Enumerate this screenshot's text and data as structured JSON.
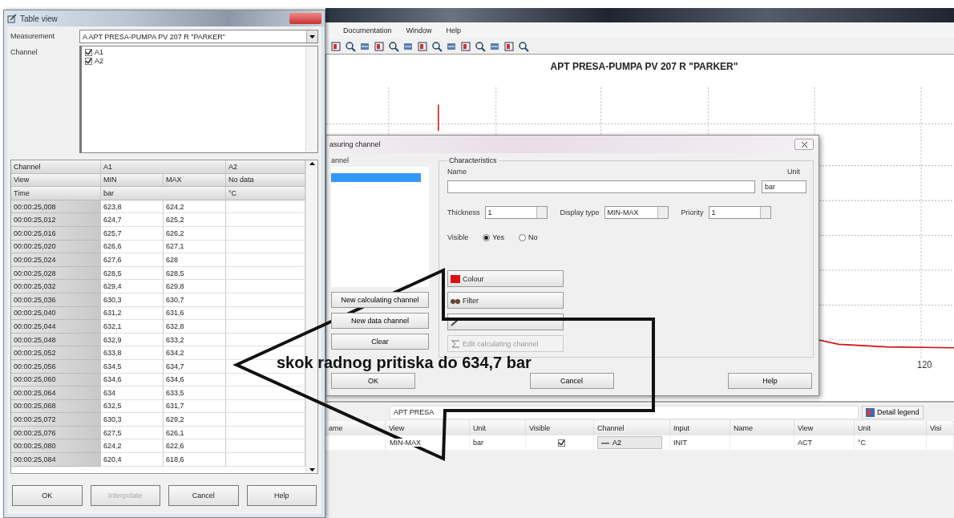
{
  "table_view": {
    "title": "Table view",
    "measurement_label": "Measurement",
    "measurement_value": "A APT PRESA-PUMPA PV 207 R \"PARKER\"",
    "channel_label": "Channel",
    "channels": [
      {
        "label": "A1",
        "checked": true
      },
      {
        "label": "A2",
        "checked": true
      }
    ],
    "header": {
      "channel": [
        "Channel",
        "A1",
        "A2"
      ],
      "view": [
        "View",
        "MIN",
        "MAX",
        "No data"
      ],
      "units": [
        "Time",
        "bar",
        "°C"
      ]
    },
    "rows": [
      {
        "time": "00:00:25,008",
        "min": "623,8",
        "max": "624,2"
      },
      {
        "time": "00:00:25,012",
        "min": "624,7",
        "max": "625,2"
      },
      {
        "time": "00:00:25,016",
        "min": "625,7",
        "max": "626,2"
      },
      {
        "time": "00:00:25,020",
        "min": "626,6",
        "max": "627,1"
      },
      {
        "time": "00:00:25,024",
        "min": "627,6",
        "max": "628"
      },
      {
        "time": "00:00:25,028",
        "min": "628,5",
        "max": "628,5"
      },
      {
        "time": "00:00:25,032",
        "min": "629,4",
        "max": "629,8"
      },
      {
        "time": "00:00:25,036",
        "min": "630,3",
        "max": "630,7"
      },
      {
        "time": "00:00:25,040",
        "min": "631,2",
        "max": "631,6"
      },
      {
        "time": "00:00:25,044",
        "min": "632,1",
        "max": "632,8"
      },
      {
        "time": "00:00:25,048",
        "min": "632,9",
        "max": "633,2"
      },
      {
        "time": "00:00:25,052",
        "min": "633,8",
        "max": "634,2"
      },
      {
        "time": "00:00:25,056",
        "min": "634,5",
        "max": "634,7"
      },
      {
        "time": "00:00:25,060",
        "min": "634,6",
        "max": "634,6"
      },
      {
        "time": "00:00:25,064",
        "min": "634",
        "max": "633,5"
      },
      {
        "time": "00:00:25,068",
        "min": "632,5",
        "max": "631,7"
      },
      {
        "time": "00:00:25,072",
        "min": "630,3",
        "max": "629,2"
      },
      {
        "time": "00:00:25,076",
        "min": "627,5",
        "max": "626,1"
      },
      {
        "time": "00:00:25,080",
        "min": "624,2",
        "max": "622,6"
      },
      {
        "time": "00:00:25,084",
        "min": "620,4",
        "max": "618,6"
      }
    ],
    "buttons": [
      {
        "label": "OK",
        "disabled": false
      },
      {
        "label": "Interpolate",
        "disabled": true
      },
      {
        "label": "Cancel",
        "disabled": false
      },
      {
        "label": "Help",
        "disabled": false
      }
    ]
  },
  "app": {
    "menu": [
      "Documentation",
      "Window",
      "Help"
    ],
    "chart_title": "APT PRESA-PUMPA PV 207 R \"PARKER\"",
    "x_tick": "120"
  },
  "dialog": {
    "title": "asuring channel",
    "channel_group": "annel",
    "list_items": [
      {
        "selected": true
      }
    ],
    "side_buttons": [
      "New calculating channel",
      "New data channel",
      "Clear"
    ],
    "characteristics": {
      "title": "Characteristics",
      "name_label": "Name",
      "unit_label": "Unit",
      "unit_value": "bar",
      "thickness_label": "Thickness",
      "thickness": "1",
      "display_type_label": "Display type",
      "display_type": "MIN-MAX",
      "priority_label": "Priority",
      "priority": "1",
      "visible_label": "Visible",
      "visible_options": [
        {
          "label": "Yes",
          "selected": true
        },
        {
          "label": "No",
          "selected": false
        }
      ],
      "buttons": [
        {
          "kind": "colour",
          "label": "Colour",
          "disabled": false
        },
        {
          "kind": "filter",
          "label": "Filter",
          "disabled": false
        },
        {
          "kind": "edit",
          "disabled": false
        },
        {
          "kind": "calc",
          "label": "Edit calculating channel",
          "disabled": true
        }
      ]
    },
    "footer_buttons": [
      "OK",
      "Cancel",
      "Help"
    ]
  },
  "legend": {
    "title": "APT PRESA",
    "detail_button": "Detail legend",
    "columns": [
      "ame",
      "View",
      "Unit",
      "Visible",
      "Channel",
      "Input",
      "Name",
      "View",
      "Unit",
      "Visi"
    ],
    "row": [
      {
        "kind": "empty"
      },
      {
        "kind": "text",
        "text": "MIN-MAX"
      },
      {
        "kind": "text",
        "text": "bar"
      },
      {
        "kind": "check",
        "checked": true
      },
      {
        "kind": "channel",
        "text": "A2"
      },
      {
        "kind": "text",
        "text": "INIT"
      },
      {
        "kind": "empty"
      },
      {
        "kind": "text",
        "text": "ACT"
      },
      {
        "kind": "text",
        "text": "°C"
      },
      {
        "kind": "empty"
      }
    ]
  },
  "annotation": {
    "text": "skok radnog pritiska do 634,7 bar"
  }
}
